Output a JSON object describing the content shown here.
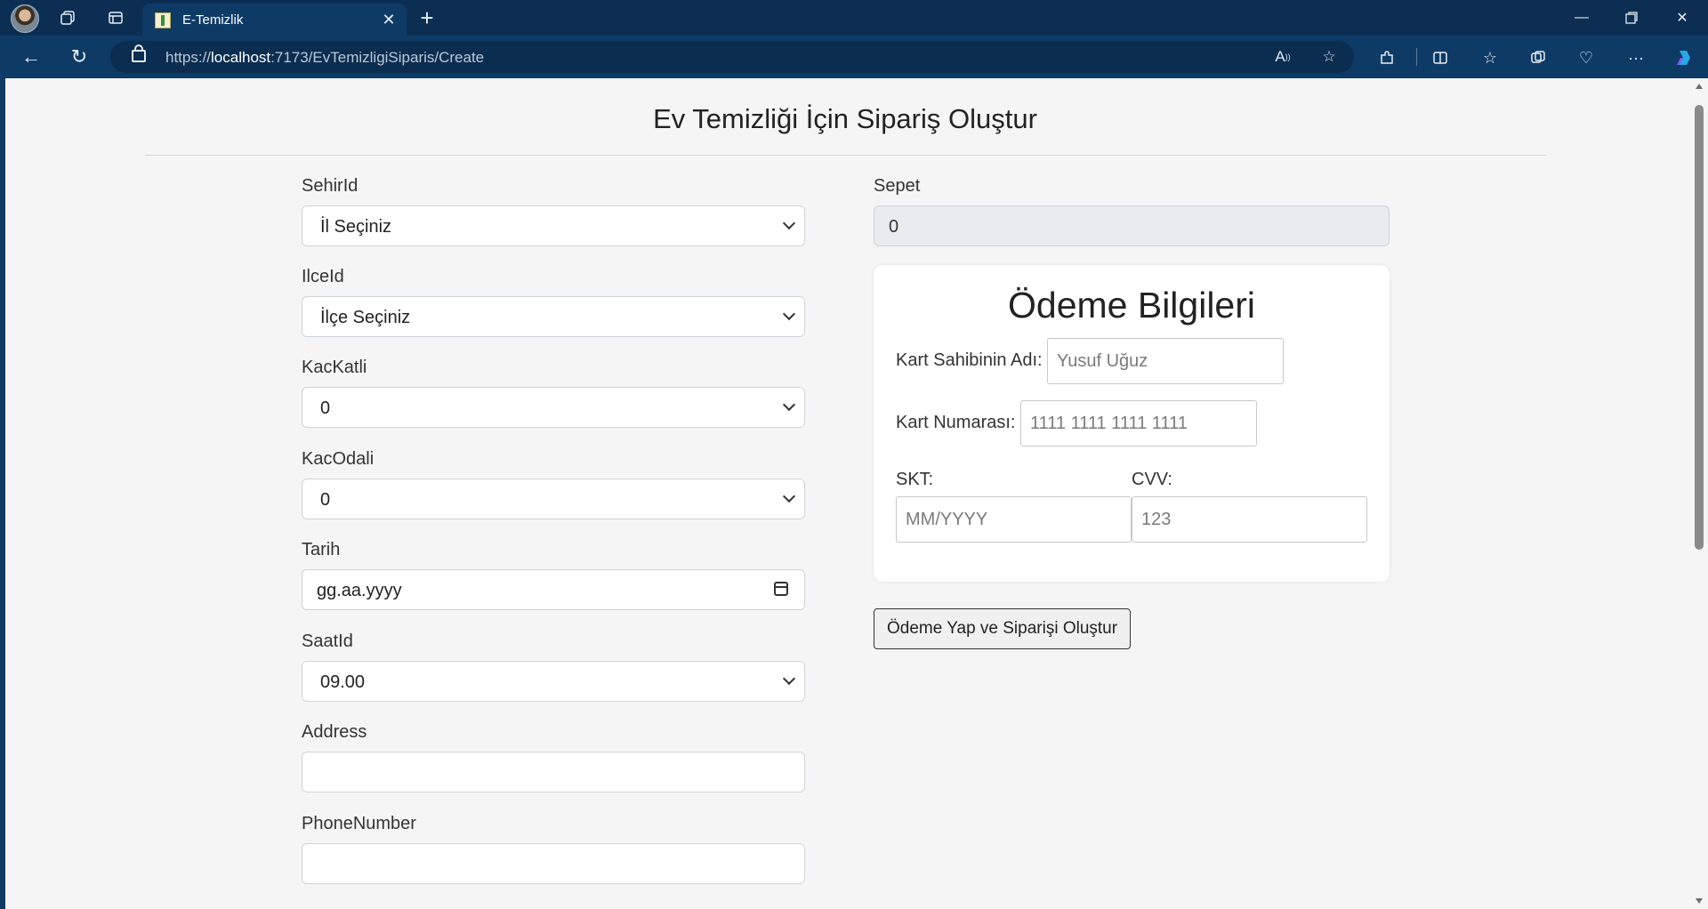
{
  "browser": {
    "tab_title": "E-Temizlik",
    "url_prefix": "https://",
    "url_host": "localhost",
    "url_path": ":7173/EvTemizligiSiparis/Create"
  },
  "page": {
    "title": "Ev Temizliği İçin Sipariş Oluştur"
  },
  "form": {
    "sehir": {
      "label": "SehirId",
      "value": "İl Seçiniz"
    },
    "ilce": {
      "label": "IlceId",
      "value": "İlçe Seçiniz"
    },
    "kackatli": {
      "label": "KacKatli",
      "value": "0"
    },
    "kacodali": {
      "label": "KacOdali",
      "value": "0"
    },
    "tarih": {
      "label": "Tarih",
      "value": "gg.aa.yyyy"
    },
    "saat": {
      "label": "SaatId",
      "value": "09.00"
    },
    "address": {
      "label": "Address",
      "value": ""
    },
    "phone": {
      "label": "PhoneNumber",
      "value": ""
    },
    "sepet": {
      "label": "Sepet",
      "value": "0"
    }
  },
  "payment": {
    "title": "Ödeme Bilgileri",
    "card_holder": {
      "label": "Kart Sahibinin Adı:",
      "placeholder": "Yusuf Uğuz"
    },
    "card_number": {
      "label": "Kart Numarası:",
      "placeholder": "1111 1111 1111 1111"
    },
    "expiry": {
      "label": "SKT:",
      "placeholder": "MM/YYYY"
    },
    "cvv": {
      "label": "CVV:",
      "placeholder": "123"
    },
    "submit_label": "Ödeme Yap ve Siparişi Oluştur"
  },
  "colors": {
    "chrome_bg": "#0e3a66",
    "page_bg": "#f5f5f5"
  }
}
